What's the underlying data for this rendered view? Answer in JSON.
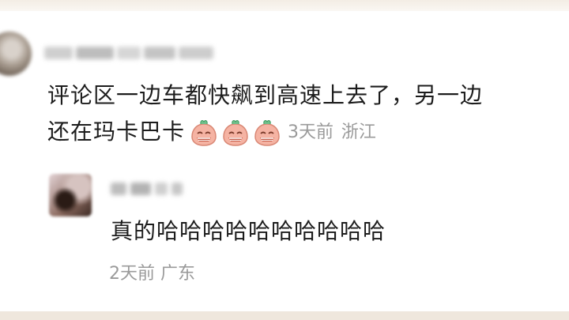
{
  "comment": {
    "text_line1": "评论区一边车都快飙到高速上去了，另一边",
    "text_line2": "还在玛卡巴卡",
    "emojis": [
      "laughing-ghost-emoji",
      "laughing-ghost-emoji",
      "laughing-ghost-emoji"
    ],
    "time": "3天前",
    "location": "浙江"
  },
  "reply": {
    "text": "真的哈哈哈哈哈哈哈哈哈哈",
    "time": "2天前",
    "location": "广东"
  }
}
